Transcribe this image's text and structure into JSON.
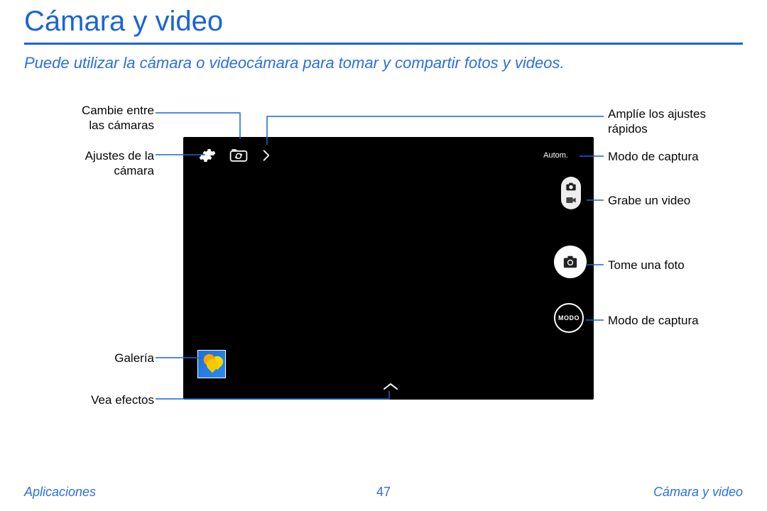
{
  "title": "Cámara y video",
  "subtitle": "Puede utilizar la cámara o videocámara para tomar y compartir fotos y videos.",
  "camera": {
    "mode_label": "Autom.",
    "mode_button": "MODO"
  },
  "callouts": {
    "left": {
      "switch_cameras": "Cambie entre las cámaras",
      "camera_settings": "Ajustes de la cámara",
      "gallery": "Galería",
      "view_effects": "Vea efectos"
    },
    "right": {
      "expand_quick": "Amplíe los ajustes rápidos",
      "capture_mode_top": "Modo de captura",
      "record_video": "Grabe un video",
      "take_photo": "Tome una foto",
      "capture_mode_bottom": "Modo de captura"
    }
  },
  "footer": {
    "left": "Aplicaciones",
    "page": "47",
    "right": "Cámara y video"
  }
}
